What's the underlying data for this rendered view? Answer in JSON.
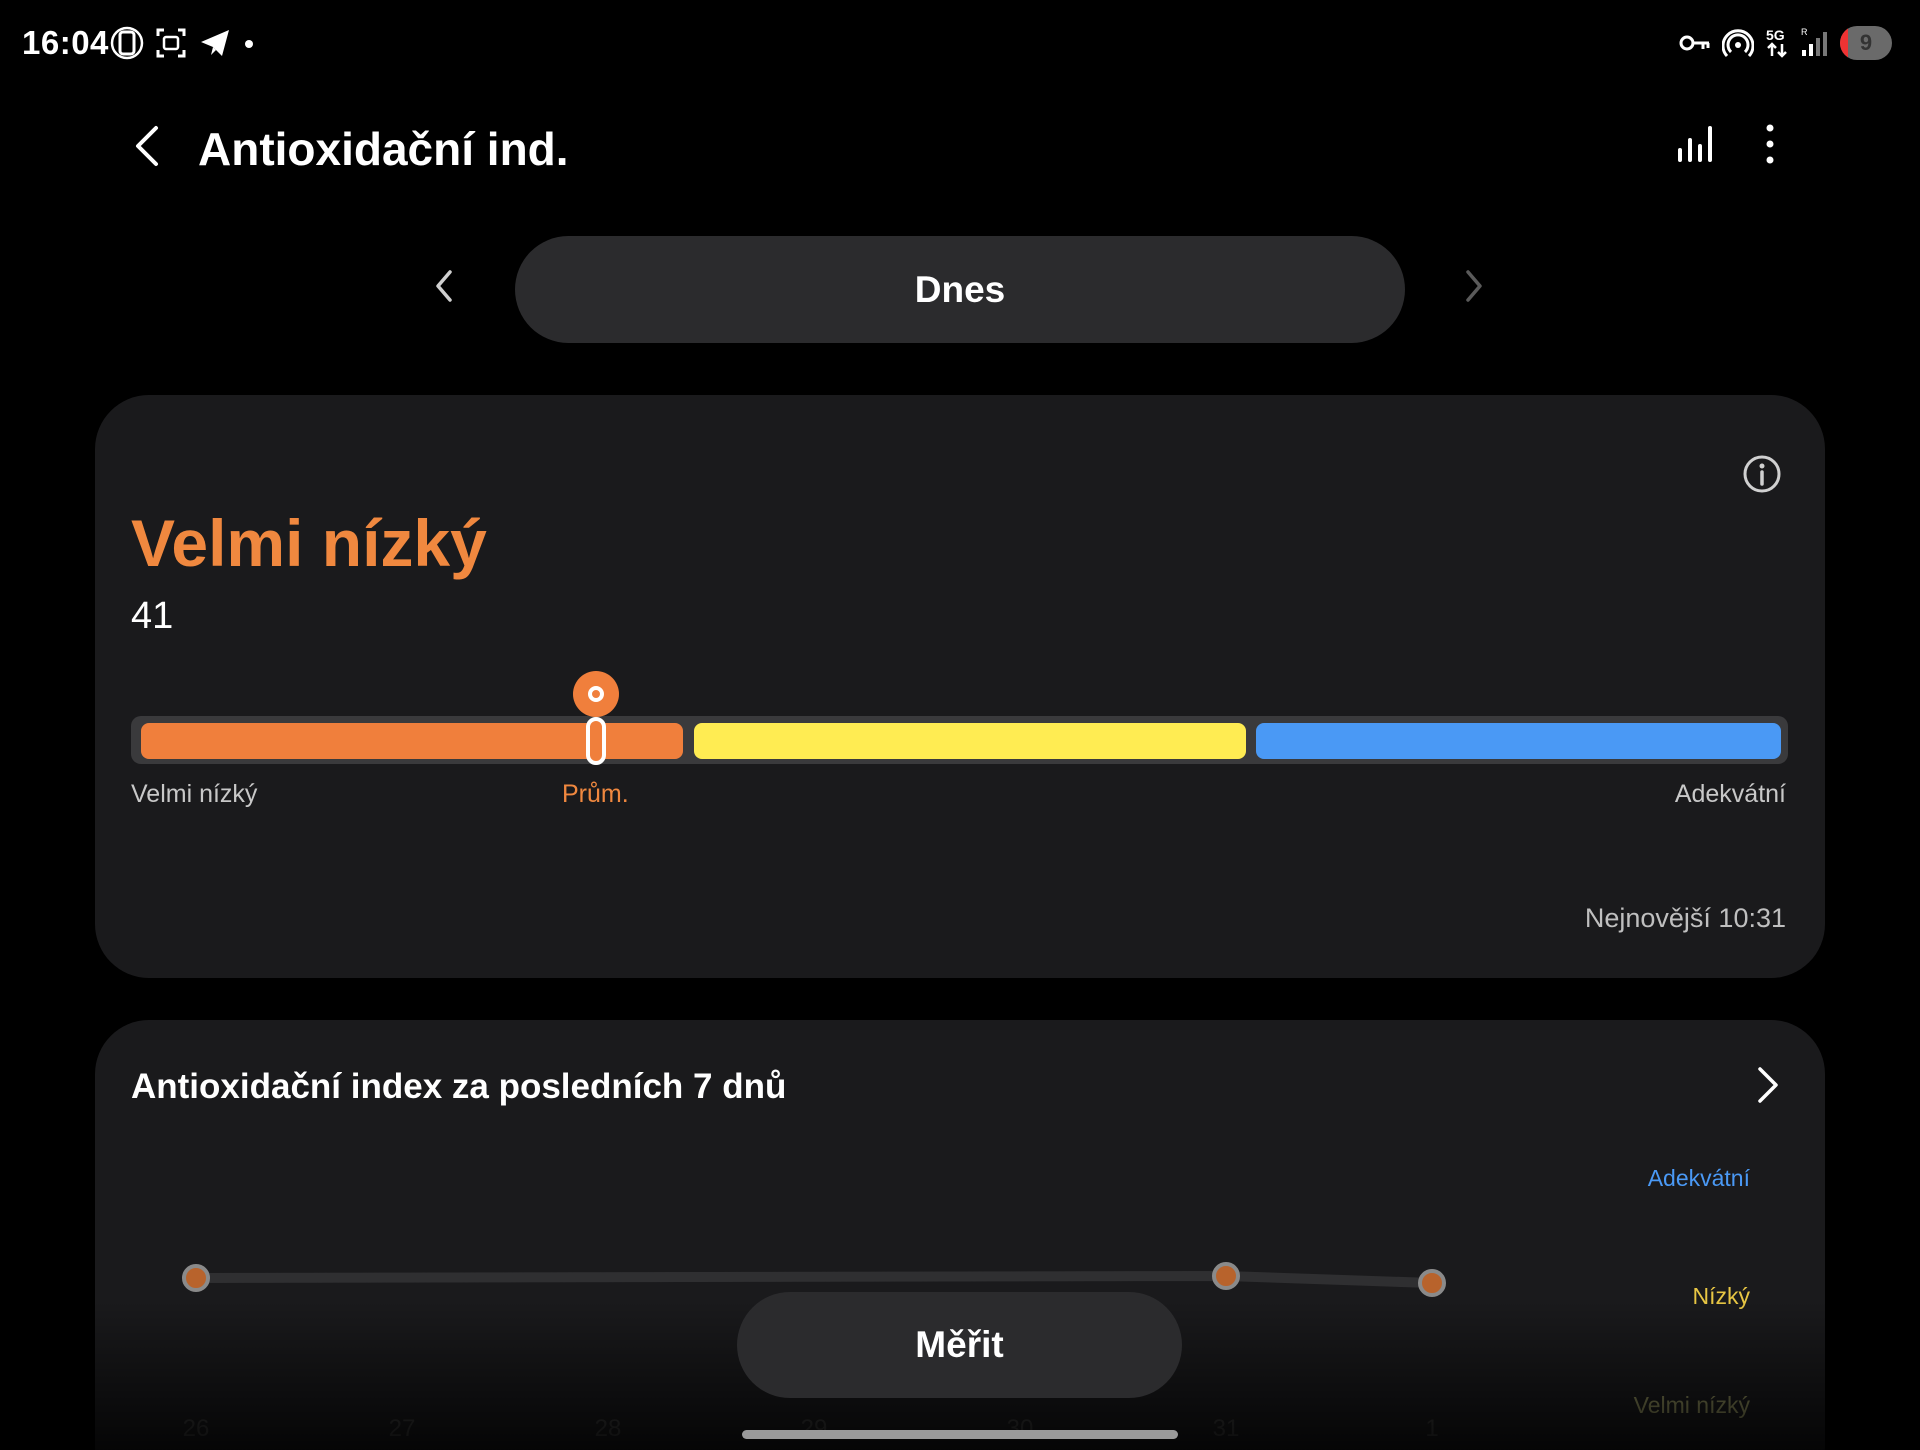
{
  "status_bar": {
    "time": "16:04",
    "left_icons": [
      "vibrate-icon",
      "screenshot-icon",
      "telegram-icon",
      "dot-icon"
    ],
    "right_icons": [
      "vpn-key-icon",
      "hotspot-icon",
      "5g-icon",
      "signal-icon"
    ],
    "battery": "9"
  },
  "header": {
    "title": "Antioxidační ind."
  },
  "date_nav": {
    "label": "Dnes"
  },
  "status_card": {
    "level": "Velmi nízký",
    "value": "41",
    "scale": {
      "low": "Velmi nízký",
      "mid": "Prům.",
      "high": "Adekvátní"
    },
    "latest": "Nejnovější 10:31",
    "colors": {
      "low": "#f07f3c",
      "mid": "#ffec52",
      "high": "#4a99f5"
    }
  },
  "weekly_card": {
    "title": "Antioxidační index za posledních 7 dnů",
    "bands": {
      "high": "Adekvátní",
      "mid": "Nízký",
      "low": "Velmi nízký"
    }
  },
  "chart_data": {
    "type": "line",
    "categories": [
      "26",
      "27",
      "28",
      "29",
      "30",
      "31",
      "1"
    ],
    "band_labels": [
      "Adekvátní",
      "Nízký",
      "Velmi nízký"
    ],
    "points": [
      {
        "x": "26",
        "level": 1.02
      },
      {
        "x": "31",
        "level": 1.04
      },
      {
        "x": "1",
        "level": 0.97
      }
    ],
    "ylim": [
      0,
      2
    ],
    "line_color": "#2f2f31",
    "point_color": "#b8632c"
  },
  "bottom": {
    "measure_label": "Měřit"
  }
}
